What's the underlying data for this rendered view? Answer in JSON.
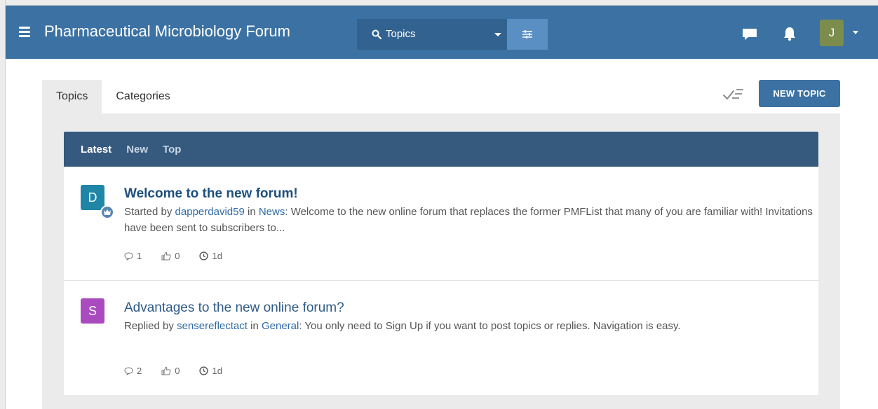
{
  "header": {
    "title": "Pharmaceutical Microbiology Forum",
    "search_scope": "Topics",
    "user_initial": "J",
    "accent": "#3c72a3"
  },
  "tabs": [
    {
      "label": "Topics",
      "active": true
    },
    {
      "label": "Categories",
      "active": false
    }
  ],
  "actions": {
    "new_topic": "NEW TOPIC"
  },
  "filters": [
    {
      "label": "Latest",
      "active": true
    },
    {
      "label": "New",
      "active": false
    },
    {
      "label": "Top",
      "active": false
    }
  ],
  "topics": [
    {
      "avatar_initial": "D",
      "avatar_color": "#1f86a8",
      "title": "Welcome to the new forum!",
      "action": "Started by",
      "author": "dapperdavid59",
      "in_word": "in",
      "category": "News",
      "excerpt": ": Welcome to the new online forum that replaces the former PMFList that many of you are familiar with! Invitations have been sent to subscribers to...",
      "replies": "1",
      "likes": "0",
      "age": "1d"
    },
    {
      "avatar_initial": "S",
      "avatar_color": "#a94bbf",
      "title": "Advantages to the new online forum?",
      "action": "Replied by",
      "author": "sensereflectact",
      "in_word": "in",
      "category": "General",
      "excerpt": ": You only need to Sign Up if you want to post topics or replies. Navigation is easy.",
      "replies": "2",
      "likes": "0",
      "age": "1d"
    }
  ]
}
